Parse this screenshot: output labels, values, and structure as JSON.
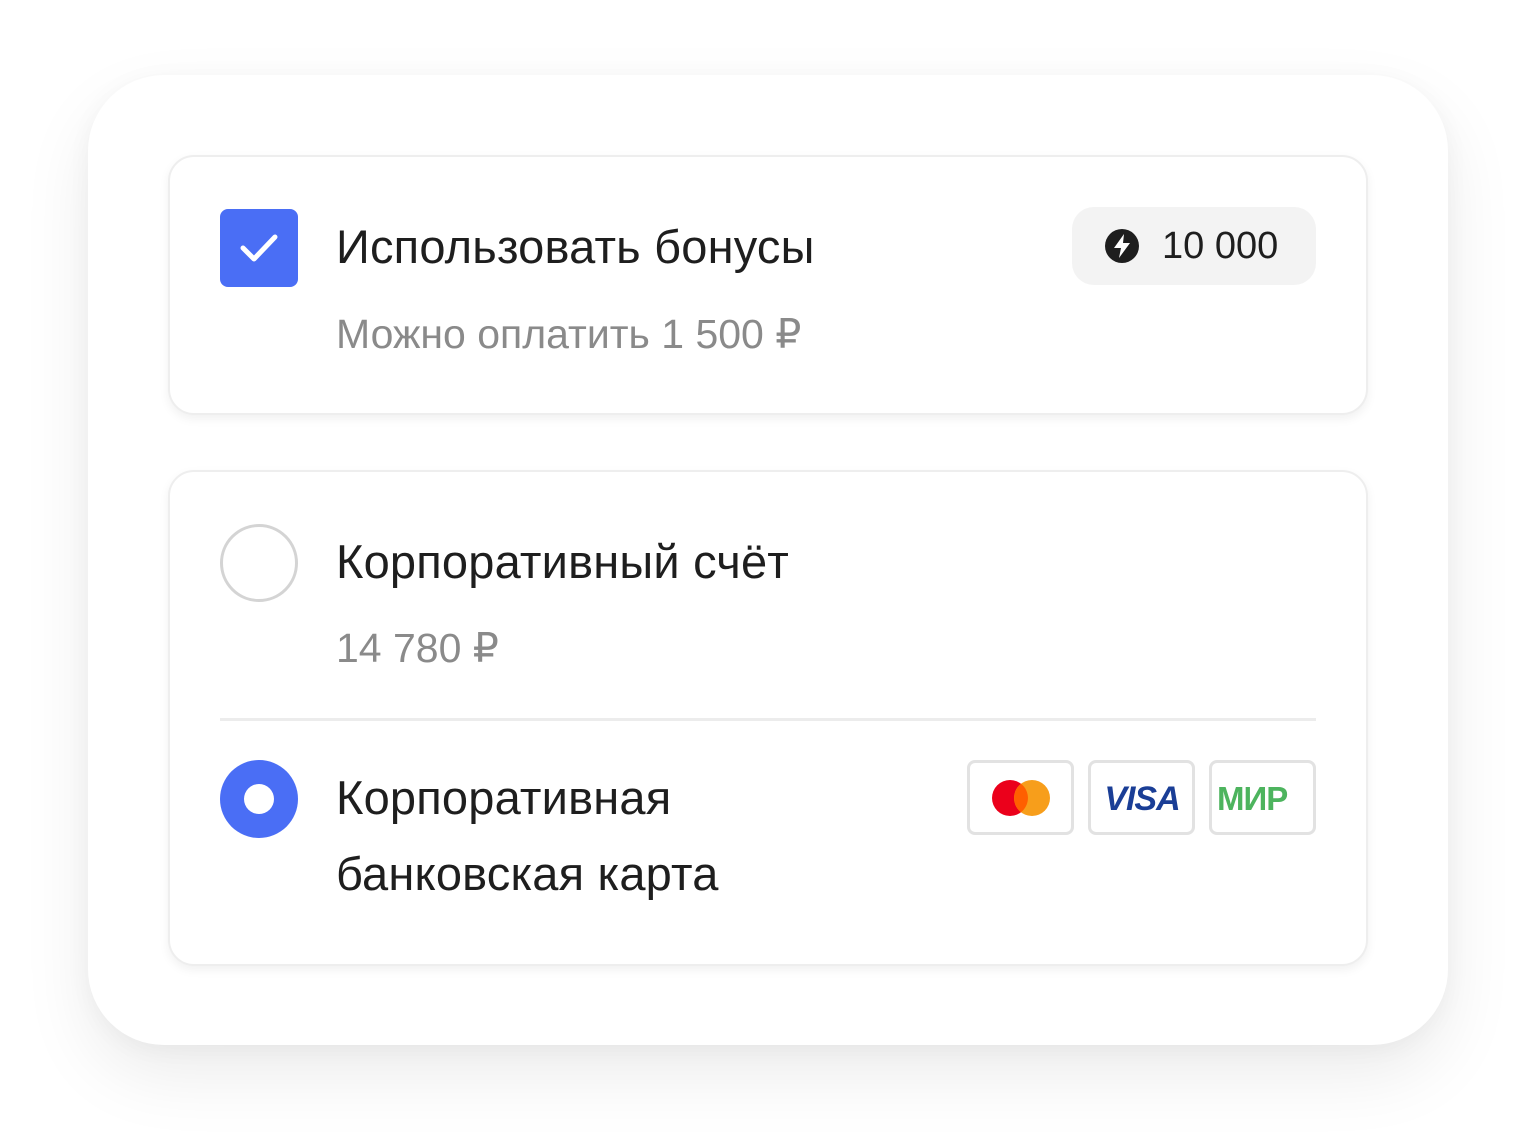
{
  "bonus": {
    "checked": true,
    "title": "Использовать бонусы",
    "subtitle": "Можно оплатить 1 500 ₽",
    "badge_value": "10 000",
    "badge_icon": "lightning-icon"
  },
  "payment_methods": [
    {
      "title": "Корпоративный счёт",
      "subtitle": "14 780 ₽",
      "selected": false
    },
    {
      "title_line1": "Корпоративная",
      "title_line2": "банковская карта",
      "selected": true,
      "card_logos": [
        "Mastercard",
        "VISA",
        "МИР"
      ]
    }
  ],
  "colors": {
    "accent": "#4a6ef5",
    "mastercard_red": "#eb001b",
    "mastercard_orange": "#f79e1b",
    "visa_blue": "#1a3e96",
    "mir_green": "#4db45e"
  }
}
